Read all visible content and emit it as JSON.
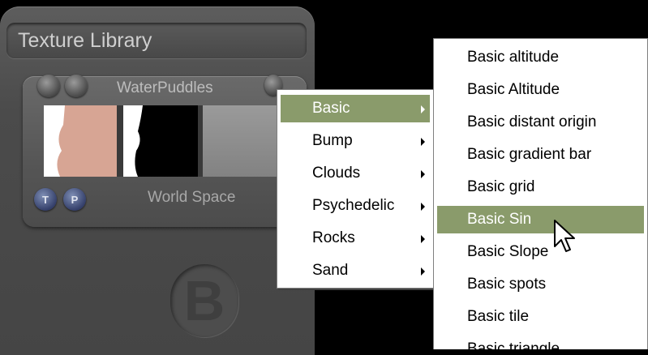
{
  "library": {
    "title": "Texture Library"
  },
  "material": {
    "name": "WaterPuddles",
    "space": "World Space",
    "button_t": "T",
    "button_p": "P"
  },
  "logo": "B",
  "submenu_main": {
    "items": [
      {
        "label": "Basic",
        "highlighted": true
      },
      {
        "label": "Bump"
      },
      {
        "label": "Clouds"
      },
      {
        "label": "Psychedelic"
      },
      {
        "label": "Rocks"
      },
      {
        "label": "Sand"
      }
    ]
  },
  "submenu_basic": {
    "items": [
      {
        "label": "Basic altitude"
      },
      {
        "label": "Basic Altitude"
      },
      {
        "label": "Basic distant origin"
      },
      {
        "label": "Basic gradient bar"
      },
      {
        "label": "Basic grid"
      },
      {
        "label": "Basic Sin",
        "highlighted": true
      },
      {
        "label": "Basic Slope"
      },
      {
        "label": "Basic spots"
      },
      {
        "label": "Basic tile"
      },
      {
        "label": "Basic triangle"
      }
    ]
  },
  "colors": {
    "highlight": "#8a9b6b"
  }
}
